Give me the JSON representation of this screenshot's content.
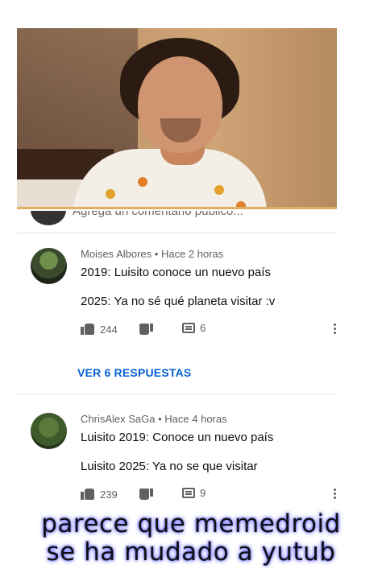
{
  "video": {
    "description_hidden": true
  },
  "add_comment": {
    "placeholder": "Agrega un comentario público..."
  },
  "comments": [
    {
      "author": "Moises Albores",
      "separator": "•",
      "time": "Hace 2 horas",
      "line1": "2019: Luisito conoce un nuevo país",
      "line2": "2025: Ya no sé qué planeta visitar :v",
      "likes": "244",
      "replies": "6"
    },
    {
      "author": "ChrisAlex SaGa",
      "separator": "•",
      "time": "Hace 4 horas",
      "line1": "Luisito 2019: Conoce un nuevo país",
      "line2": "Luisito 2025: Ya no se que visitar",
      "likes": "239",
      "replies": "9"
    }
  ],
  "view_replies": "VER 6 RESPUESTAS",
  "caption": {
    "line1": "parece que memedroid",
    "line2": "se ha mudado a yutub"
  },
  "colors": {
    "link": "#065fd4",
    "caption_glow": "#5a5cff"
  }
}
